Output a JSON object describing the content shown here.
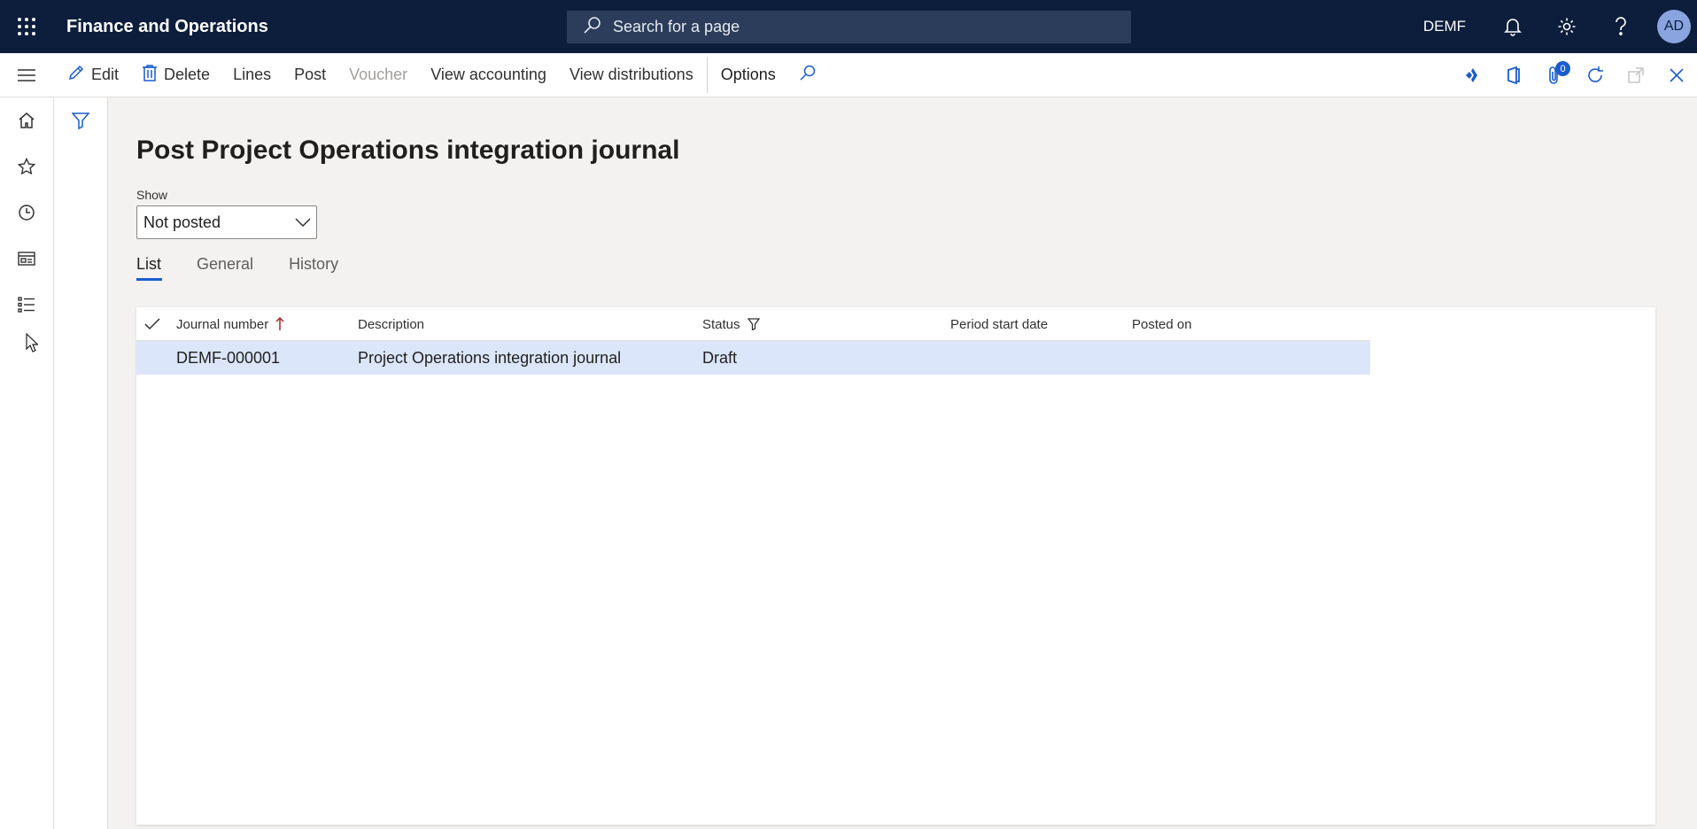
{
  "app": {
    "title": "Finance and Operations"
  },
  "search": {
    "placeholder": "Search for a page"
  },
  "topbar": {
    "company": "DEMF",
    "avatar_initials": "AD"
  },
  "actions": {
    "edit": "Edit",
    "delete": "Delete",
    "lines": "Lines",
    "post": "Post",
    "voucher": "Voucher",
    "view_accounting": "View accounting",
    "view_distributions": "View distributions",
    "options": "Options",
    "attachments_count": "0"
  },
  "page": {
    "title": "Post Project Operations integration journal",
    "show_label": "Show",
    "show_value": "Not posted"
  },
  "tabs": [
    {
      "label": "List",
      "active": true
    },
    {
      "label": "General",
      "active": false
    },
    {
      "label": "History",
      "active": false
    }
  ],
  "grid": {
    "columns": {
      "journal_number": "Journal number",
      "description": "Description",
      "status": "Status",
      "period_start_date": "Period start date",
      "posted_on": "Posted on"
    },
    "rows": [
      {
        "journal_number": "DEMF-000001",
        "description": "Project Operations integration journal",
        "status": "Draft",
        "period_start_date": "",
        "posted_on": ""
      }
    ]
  },
  "colors": {
    "topbar": "#0c1e3c",
    "accent": "#1a5ccc",
    "selected_row": "#dce6fa"
  }
}
